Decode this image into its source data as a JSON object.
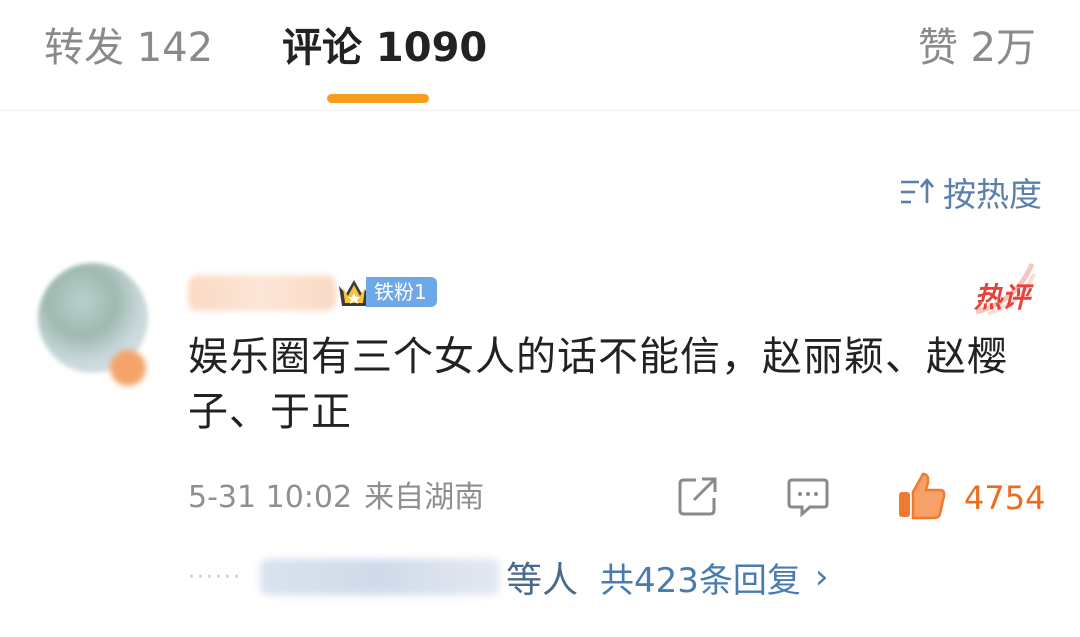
{
  "tabs": {
    "repost": "转发 142",
    "comment": "评论 1090",
    "like": "赞 2万"
  },
  "sort": {
    "label": "按热度",
    "icon": "sort-icon"
  },
  "comment": {
    "fan_badge": "铁粉1",
    "hot_tag": "热评",
    "text": "娱乐圈有三个女人的话不能信，赵丽颖、赵樱子、于正",
    "date": "5-31 10:02",
    "location": "来自湖南",
    "like_count": "4754"
  },
  "replies": {
    "dots": "······",
    "person_suffix": "等人",
    "total": "共423条回复",
    "chevron": "›"
  },
  "colors": {
    "accent": "#f79d1e",
    "link": "#4a7bb0",
    "like": "#f06a1e",
    "hot": "#e8433b"
  }
}
